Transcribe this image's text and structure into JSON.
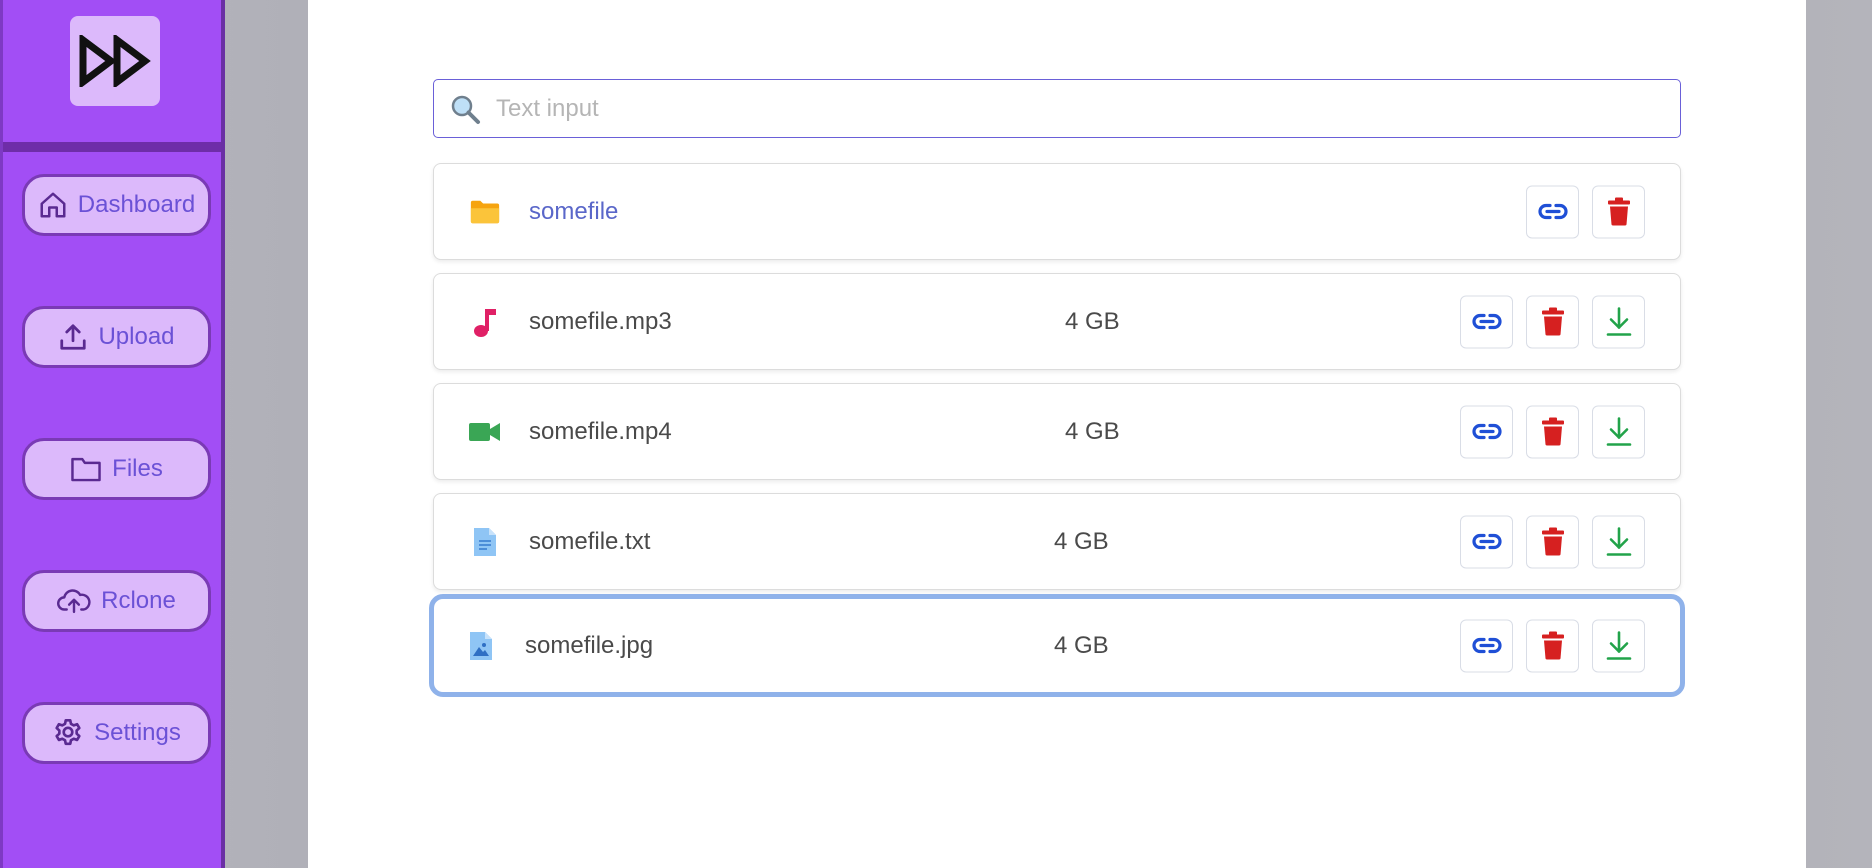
{
  "sidebar": {
    "logo_icon": "fast-forward-logo-icon",
    "items": [
      {
        "label": "Dashboard",
        "icon": "home-icon"
      },
      {
        "label": "Upload",
        "icon": "upload-icon"
      },
      {
        "label": "Files",
        "icon": "folder-icon"
      },
      {
        "label": "Rclone",
        "icon": "cloud-upload-icon"
      },
      {
        "label": "Settings",
        "icon": "gear-icon"
      }
    ]
  },
  "search": {
    "placeholder": "Text input",
    "value": "",
    "icon": "search-icon"
  },
  "files": [
    {
      "name": "somefile",
      "size": "",
      "type": "folder",
      "icon": "folder-icon",
      "actions": [
        "link",
        "delete"
      ]
    },
    {
      "name": "somefile.mp3",
      "size": "4 GB",
      "type": "audio",
      "icon": "music-note-icon",
      "actions": [
        "link",
        "delete",
        "download"
      ]
    },
    {
      "name": "somefile.mp4",
      "size": "4 GB",
      "type": "video",
      "icon": "video-camera-icon",
      "actions": [
        "link",
        "delete",
        "download"
      ]
    },
    {
      "name": "somefile.txt",
      "size": "4 GB",
      "type": "text",
      "icon": "text-file-icon",
      "actions": [
        "link",
        "delete",
        "download"
      ]
    },
    {
      "name": "somefile.jpg",
      "size": "4 GB",
      "type": "image",
      "icon": "image-file-icon",
      "actions": [
        "link",
        "delete",
        "download"
      ],
      "selected": true
    }
  ],
  "colors": {
    "sidebar": "#a24ef5",
    "nav_button": "#dcb9fb",
    "nav_label": "#6b51d6",
    "link_action": "#1f4fd6",
    "delete_action": "#d62020",
    "download_action": "#22a34a",
    "selected_border": "#8fb2ea"
  }
}
